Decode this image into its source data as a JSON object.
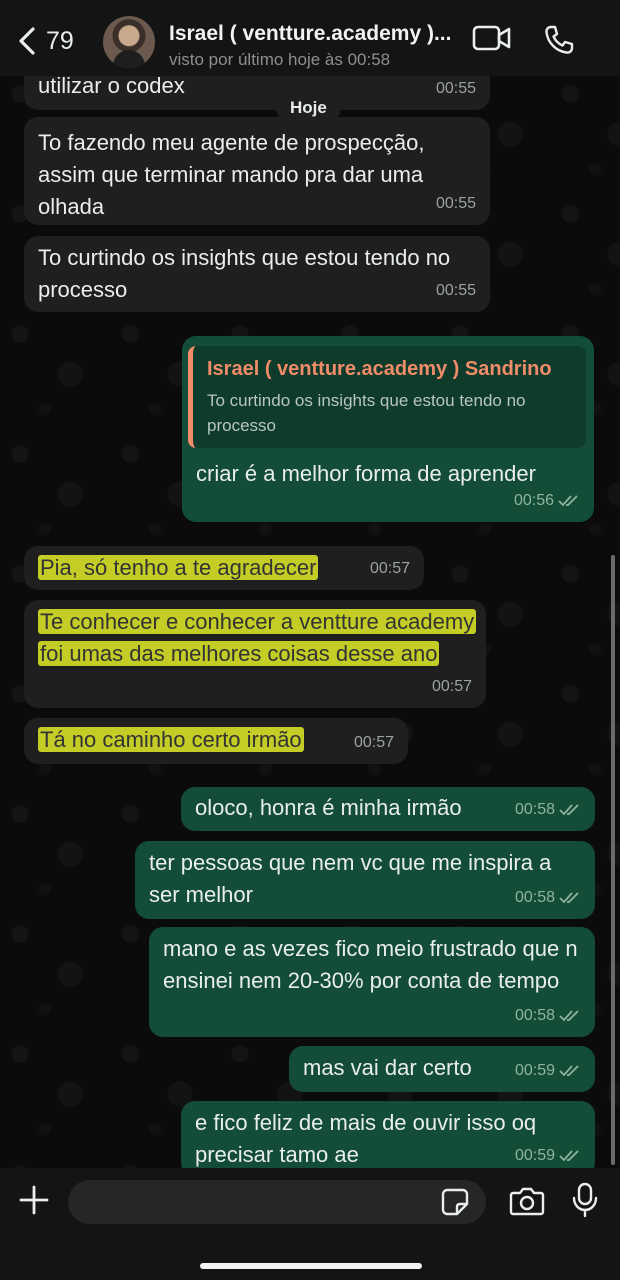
{
  "header": {
    "back_count": "79",
    "contact_name": "Israel ( ventture.academy )...",
    "status": "visto por último hoje às 00:58"
  },
  "date_separator": "Hoje",
  "messages": [
    {
      "dir": "in",
      "text": "utilizar o codex",
      "time": "00:55"
    },
    {
      "dir": "in",
      "text": "To fazendo meu agente de prospecção, assim que terminar mando pra dar uma olhada",
      "time": "00:55"
    },
    {
      "dir": "in",
      "text": "To curtindo os insights que estou tendo no processo",
      "time": "00:55"
    },
    {
      "dir": "out",
      "quote_author": "Israel ( ventture.academy ) Sandrino",
      "quote_text": "To curtindo os insights que estou tendo no processo",
      "text": "criar é a melhor forma de aprender",
      "time": "00:56"
    },
    {
      "dir": "in",
      "text": "Pia, só tenho a te agradecer",
      "time": "00:57",
      "highlighted": true
    },
    {
      "dir": "in",
      "text": "Te conhecer e conhecer a ventture academy foi umas das melhores coisas desse ano",
      "time": "00:57",
      "highlighted": true
    },
    {
      "dir": "in",
      "text": "Tá no caminho certo irmão",
      "time": "00:57",
      "highlighted": true
    },
    {
      "dir": "out",
      "text": "oloco, honra é minha irmão",
      "time": "00:58"
    },
    {
      "dir": "out",
      "text": "ter pessoas que nem vc que me inspira a ser melhor",
      "time": "00:58"
    },
    {
      "dir": "out",
      "text": "mano e as vezes fico meio frustrado que n ensinei nem 20-30%  por conta de tempo",
      "time": "00:58"
    },
    {
      "dir": "out",
      "text": "mas vai dar certo",
      "time": "00:59"
    },
    {
      "dir": "out",
      "text": "e fico feliz de mais de ouvir isso oq precisar tamo ae",
      "time": "00:59"
    }
  ],
  "input": {
    "placeholder": "",
    "value": ""
  },
  "colors": {
    "incoming": "#1f1f1f",
    "outgoing": "#144d37",
    "quote_accent": "#f08c6a",
    "highlight": "#dce628"
  },
  "icons": [
    "chevron-left-icon",
    "video-icon",
    "phone-icon",
    "plus-icon",
    "sticker-icon",
    "camera-icon",
    "microphone-icon",
    "double-check-icon"
  ]
}
